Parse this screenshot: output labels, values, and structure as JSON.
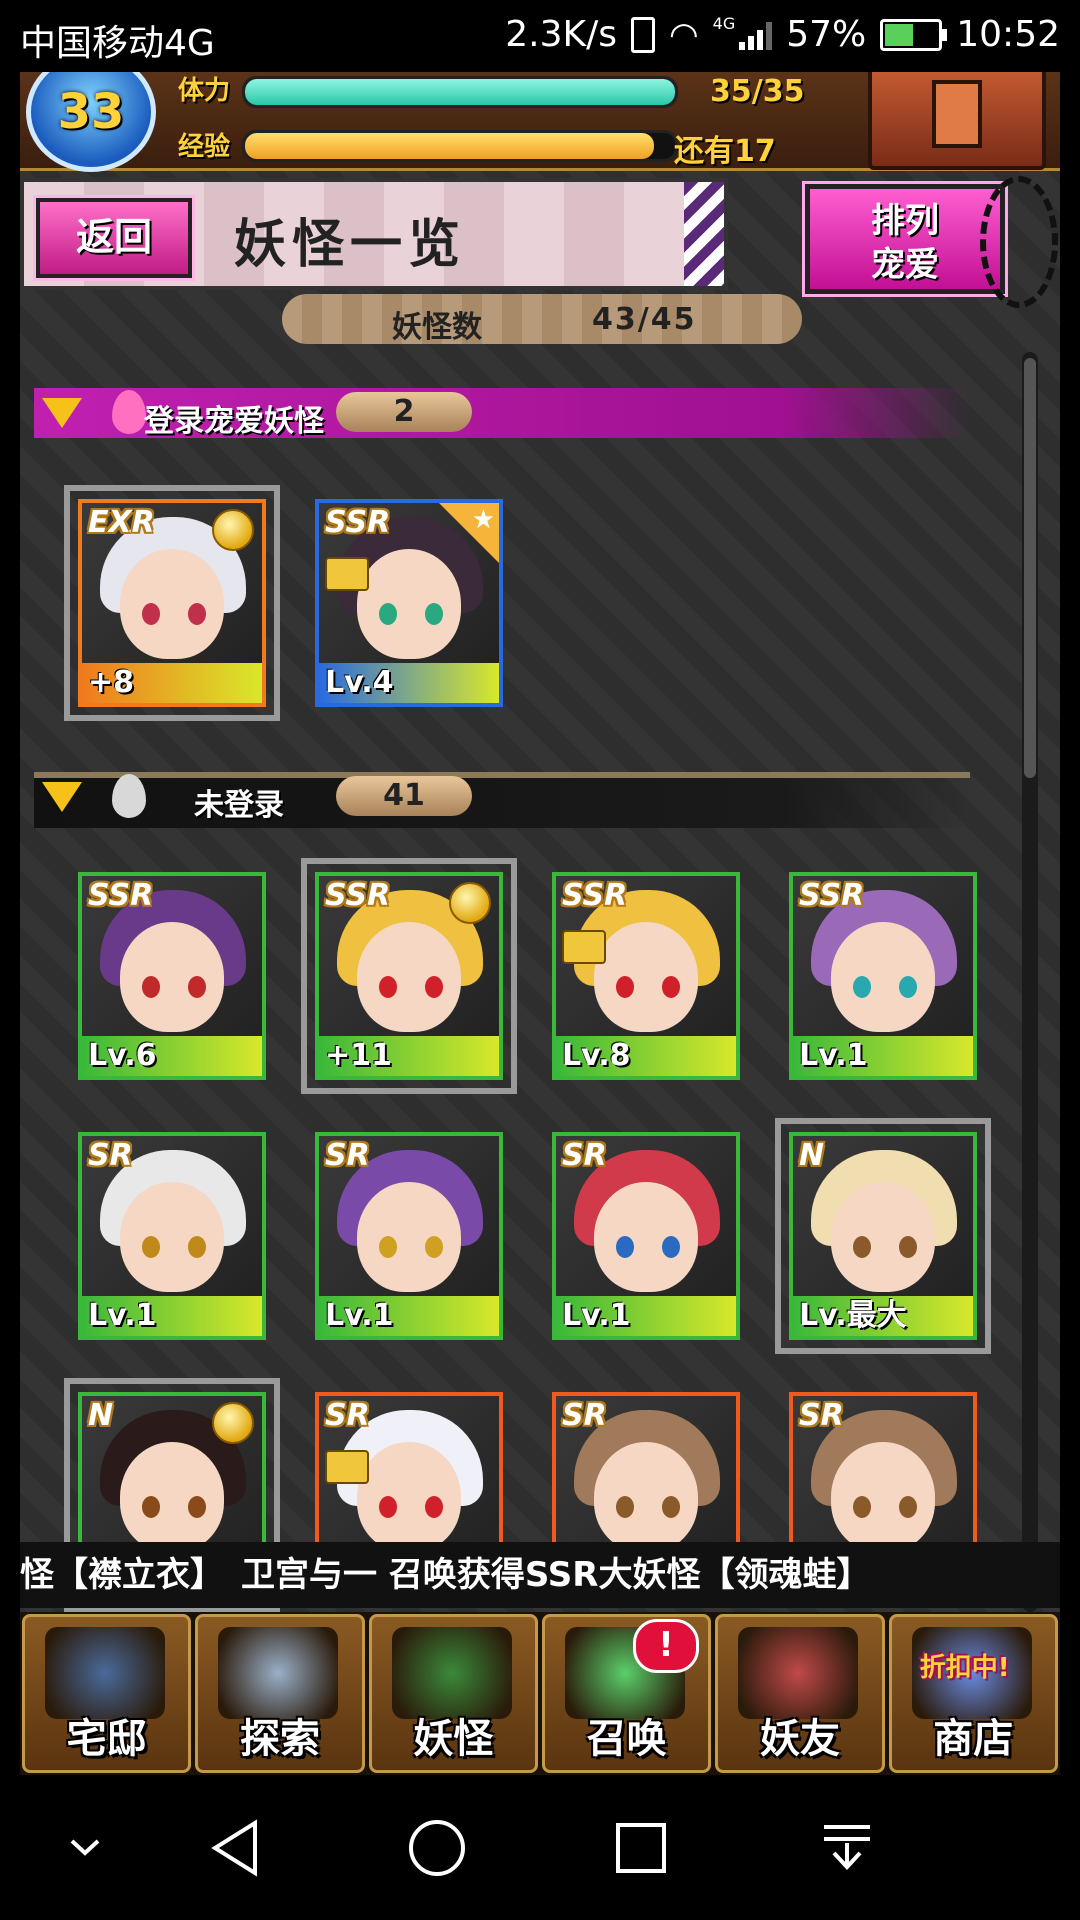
{
  "status_bar": {
    "carrier": "中国移动4G",
    "net_speed": "2.3K/s",
    "network_type": "4G",
    "battery_percent": "57%",
    "battery_level": 0.57,
    "time": "10:52"
  },
  "header": {
    "player_level": "33",
    "stamina_label": "体力",
    "stamina_value": "35/35",
    "stamina_fraction": 1.0,
    "exp_label": "经验",
    "exp_remaining": "还有17",
    "exp_fraction": 0.95
  },
  "title_bar": {
    "back_label": "返回",
    "title": "妖怪一览",
    "sort_label_line1": "排列",
    "sort_label_line2": "宠爱"
  },
  "monster_count": {
    "label": "妖怪数",
    "value": "43/45"
  },
  "sections": {
    "favorites": {
      "label": "登录宠爱妖怪",
      "count": "2",
      "cards": [
        {
          "rarity": "EXR",
          "level": "+8",
          "medal": true,
          "selected": true,
          "frame": "#f07a1e",
          "hair": "#e6e6ee",
          "eye": "#c0304a"
        },
        {
          "rarity": "SSR",
          "level": "Lv.4",
          "lock": true,
          "star": true,
          "frame": "#2a6ae0",
          "hair": "#3a2a3a",
          "eye": "#2aa880"
        }
      ]
    },
    "unregistered": {
      "label": "未登录",
      "count": "41",
      "cards": [
        {
          "rarity": "SSR",
          "level": "Lv.6",
          "frame": "#3ab83a",
          "hair": "#6a3a8a",
          "eye": "#c02a2a"
        },
        {
          "rarity": "SSR",
          "level": "+11",
          "medal": true,
          "selected": true,
          "frame": "#3ab83a",
          "hair": "#f0c040",
          "eye": "#d0202a"
        },
        {
          "rarity": "SSR",
          "level": "Lv.8",
          "lock": true,
          "frame": "#3ab83a",
          "hair": "#f0c040",
          "eye": "#d0202a"
        },
        {
          "rarity": "SSR",
          "level": "Lv.1",
          "frame": "#3ab83a",
          "hair": "#9a6ab8",
          "eye": "#2aa8b0"
        },
        {
          "rarity": "SR",
          "level": "Lv.1",
          "frame": "#3ab83a",
          "hair": "#e8e8e8",
          "eye": "#c08a1a"
        },
        {
          "rarity": "SR",
          "level": "Lv.1",
          "frame": "#3ab83a",
          "hair": "#7a4aa8",
          "eye": "#d0a020"
        },
        {
          "rarity": "SR",
          "level": "Lv.1",
          "frame": "#3ab83a",
          "hair": "#d03a4a",
          "eye": "#2a6ac0"
        },
        {
          "rarity": "N",
          "level": "Lv.最大",
          "selected": true,
          "frame": "#3ab83a",
          "hair": "#f0ddb0",
          "eye": "#8a5a2a"
        },
        {
          "rarity": "N",
          "level": "",
          "medal": true,
          "selected": true,
          "frame": "#3ab83a",
          "hair": "#2a1a1a",
          "eye": "#8a4a1a"
        },
        {
          "rarity": "SR",
          "level": "",
          "lock": true,
          "frame": "#f05a1e",
          "hair": "#f0f0f8",
          "eye": "#d0202a"
        },
        {
          "rarity": "SR",
          "level": "",
          "frame": "#f05a1e",
          "hair": "#a07a5a",
          "eye": "#8a5a2a"
        },
        {
          "rarity": "SR",
          "level": "",
          "frame": "#f05a1e",
          "hair": "#a07a5a",
          "eye": "#8a5a2a"
        }
      ]
    }
  },
  "ticker": {
    "text": "怪【襟立衣】　卫宫与一 召唤获得SSR大妖怪【领魂蛙】"
  },
  "nav": {
    "items": [
      {
        "label": "宅邸",
        "icon": "house-icon",
        "color": "#4a6a9a"
      },
      {
        "label": "探索",
        "icon": "magnifier-icon",
        "color": "#9ab0c8"
      },
      {
        "label": "妖怪",
        "icon": "scroll-icon",
        "color": "#3a8a3a"
      },
      {
        "label": "召唤",
        "icon": "pentagram-icon",
        "color": "#5ad06a",
        "alert": "!"
      },
      {
        "label": "妖友",
        "icon": "catgirl-icon",
        "color": "#c04a4a"
      },
      {
        "label": "商店",
        "icon": "orb-icon",
        "color": "#6a8ae0",
        "sale": "折扣中!"
      }
    ]
  }
}
